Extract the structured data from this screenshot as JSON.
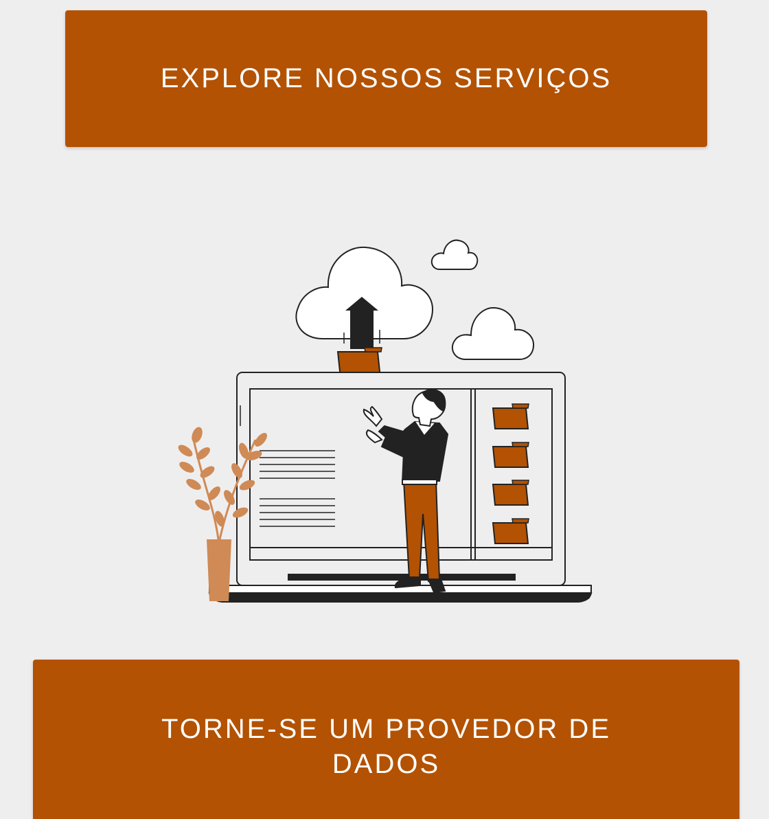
{
  "buttons": {
    "explore_label": "EXPLORE NOSSOS SERVIÇOS",
    "provider_label": "TORNE-SE UM PROVEDOR DE DADOS"
  },
  "colors": {
    "accent": "#b35202",
    "background": "#efeeef",
    "plant": "#cf8a55",
    "ink": "#222222"
  },
  "illustration": {
    "icons": [
      "cloud-icon",
      "upload-arrow-icon",
      "folder-icon",
      "laptop-icon",
      "person-icon",
      "plant-icon"
    ]
  }
}
